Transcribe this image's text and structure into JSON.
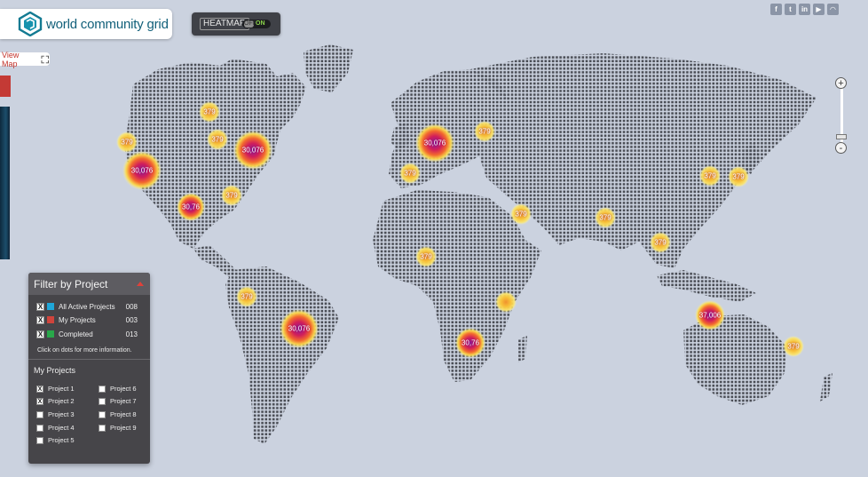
{
  "brand": {
    "name": "world community grid"
  },
  "view_map": {
    "label": "View Map",
    "icon": "expand-icon"
  },
  "heatmap": {
    "label": "HEATMAP",
    "off_label": "OFF",
    "on_label": "ON",
    "state": "on"
  },
  "social": [
    {
      "name": "facebook",
      "glyph": "f"
    },
    {
      "name": "twitter",
      "glyph": "t"
    },
    {
      "name": "linkedin",
      "glyph": "in"
    },
    {
      "name": "youtube",
      "glyph": "▶"
    },
    {
      "name": "rss",
      "glyph": "◠"
    }
  ],
  "zoom": {
    "in_label": "+",
    "out_label": "-"
  },
  "filter": {
    "title": "Filter by Project",
    "rows": [
      {
        "label": "All Active Projects",
        "count": "008",
        "color": "#1fa7d9",
        "checked": true
      },
      {
        "label": "My Projects",
        "count": "003",
        "color": "#d0443c",
        "checked": true
      },
      {
        "label": "Completed",
        "count": "013",
        "color": "#29a84a",
        "checked": true
      }
    ],
    "hint": "Click on dots for more information.",
    "my_projects_title": "My Projects",
    "projects": [
      {
        "label": "Project 1",
        "checked": true
      },
      {
        "label": "Project 2",
        "checked": true
      },
      {
        "label": "Project 3",
        "checked": false
      },
      {
        "label": "Project 4",
        "checked": false
      },
      {
        "label": "Project 5",
        "checked": false
      },
      {
        "label": "Project 6",
        "checked": false
      },
      {
        "label": "Project 7",
        "checked": false
      },
      {
        "label": "Project 8",
        "checked": false
      },
      {
        "label": "Project 9",
        "checked": false
      }
    ]
  },
  "markers": [
    {
      "label": "379",
      "size": "small"
    },
    {
      "label": "379",
      "size": "small"
    },
    {
      "label": "379",
      "size": "small"
    },
    {
      "label": "30,076",
      "size": "large"
    },
    {
      "label": "30,076",
      "size": "large"
    },
    {
      "label": "379",
      "size": "small"
    },
    {
      "label": "30,76",
      "size": "medium"
    },
    {
      "label": "30,076",
      "size": "large"
    },
    {
      "label": "379",
      "size": "small"
    },
    {
      "label": "379",
      "size": "small"
    },
    {
      "label": "379",
      "size": "small"
    },
    {
      "label": "379",
      "size": "small"
    },
    {
      "label": "379",
      "size": "small"
    },
    {
      "label": "379",
      "size": "small"
    },
    {
      "label": "379",
      "size": "small"
    },
    {
      "label": "379",
      "size": "small"
    },
    {
      "label": "30,076",
      "size": "large"
    },
    {
      "label": "379",
      "size": "small"
    },
    {
      "label": "30,76",
      "size": "medium"
    },
    {
      "label": "37,006",
      "size": "medium"
    },
    {
      "label": "379",
      "size": "small"
    }
  ]
}
